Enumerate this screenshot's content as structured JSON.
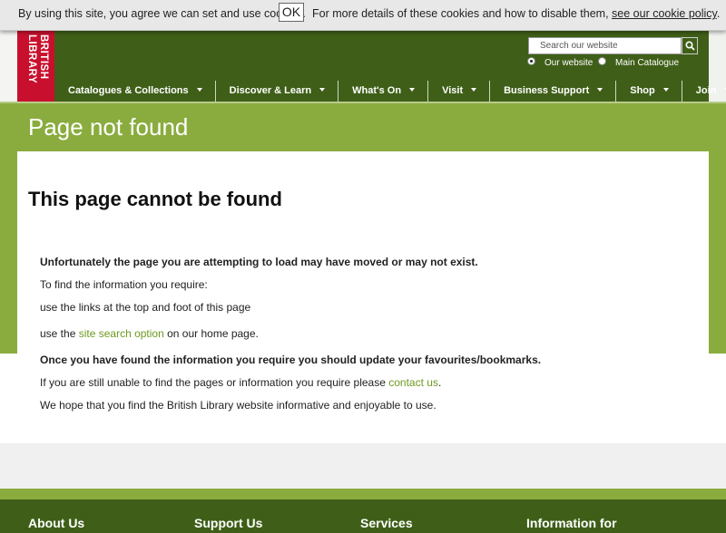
{
  "cookie_bar": {
    "message": "By using this site, you agree we can set and use cookies.",
    "ok_label": "OK",
    "details_prefix": "For more details of these cookies and how to disable them,",
    "policy_link": "see our cookie policy",
    "suffix": "."
  },
  "logo": {
    "text_line1": "BRITISH",
    "text_line2": "LIBRARY"
  },
  "search": {
    "placeholder": "Search our website",
    "options": [
      "Our website",
      "Main Catalogue"
    ],
    "selected": "Our website",
    "button_icon": "search-icon"
  },
  "nav": {
    "items": [
      {
        "label": "Catalogues & Collections"
      },
      {
        "label": "Discover & Learn"
      },
      {
        "label": "What's On"
      },
      {
        "label": "Visit"
      },
      {
        "label": "Business Support"
      },
      {
        "label": "Shop"
      },
      {
        "label": "Join"
      }
    ]
  },
  "page": {
    "title": "Page not found",
    "heading": "This page cannot be found",
    "lines": {
      "l1": "Unfortunately the page you are attempting to load may have moved or may not exist.",
      "l2": "To find the information you require:",
      "l3": "use the links at the top and foot of this page",
      "l4_prefix": "use the",
      "l4_link": "site search option",
      "l4_suffix": "on our home page.",
      "l5": "Once you have found the information you require you should update your favourites/bookmarks.",
      "l6_prefix": "If you are still unable to find the pages or information you require please",
      "l6_link": "contact us",
      "l6_suffix": ".",
      "l7": "We hope that you find the British Library website informative and enjoyable to use."
    }
  },
  "footer": {
    "columns": [
      "About Us",
      "Support Us",
      "Services",
      "Information for"
    ]
  },
  "colors": {
    "header_green": "#3f5f18",
    "band_green": "#8aac3e",
    "logo_red": "#c8102e",
    "link_green": "#6f9a20"
  }
}
